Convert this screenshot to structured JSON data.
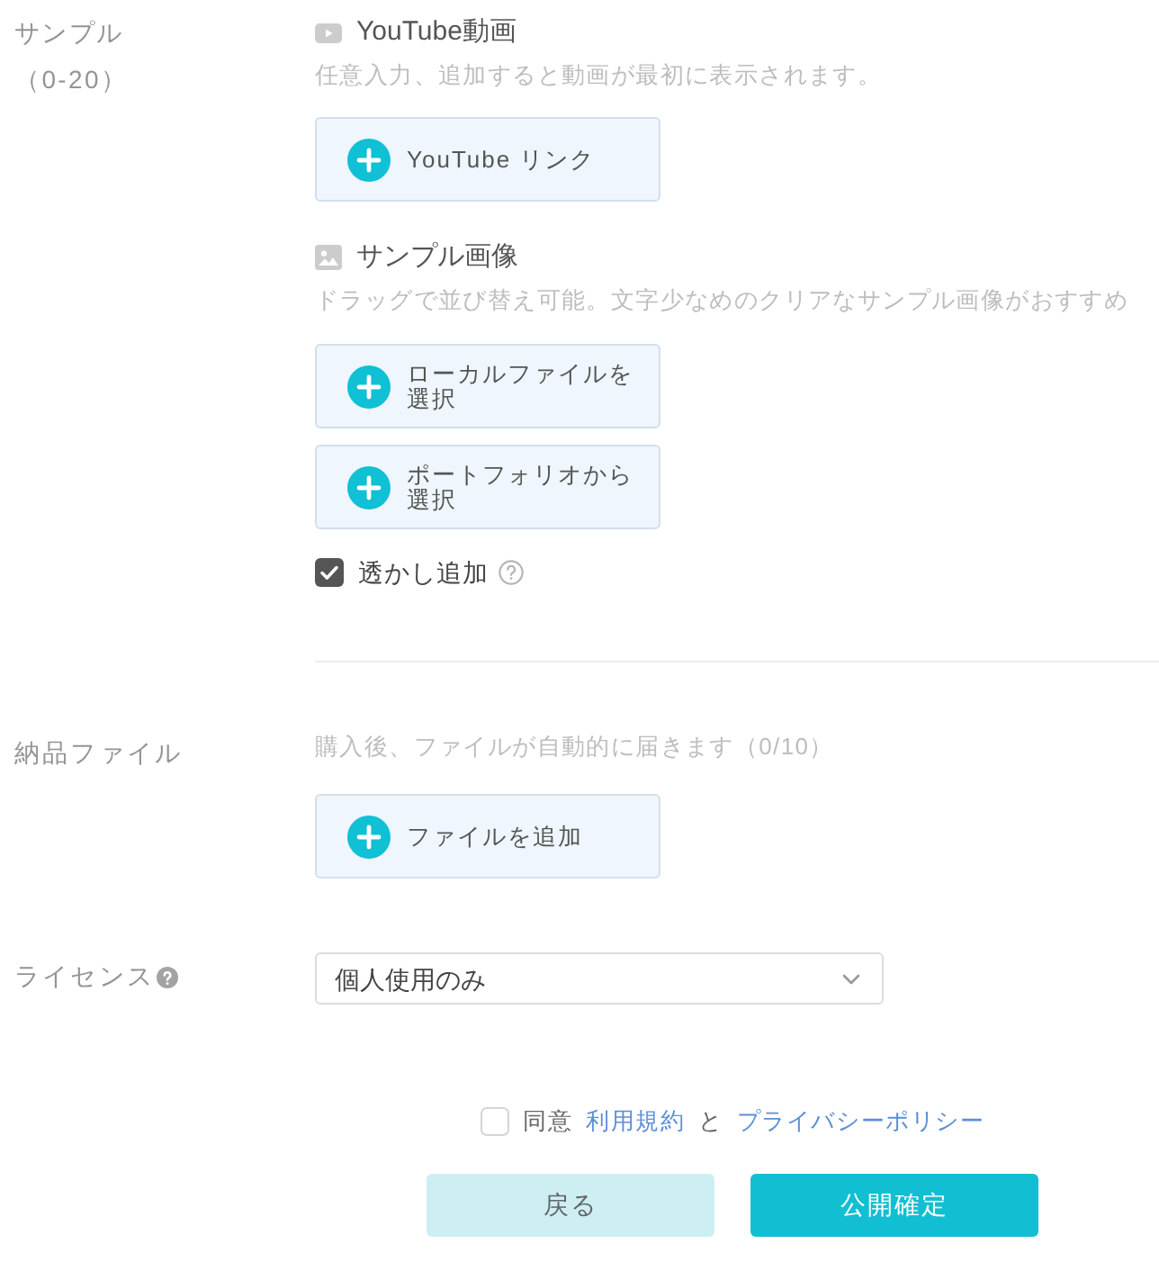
{
  "sample_section": {
    "label": "サンプル",
    "count": "（0-20）",
    "youtube": {
      "title": "YouTube動画",
      "hint": "任意入力、追加すると動画が最初に表示されます。",
      "buttons": [
        {
          "label": "YouTube リンク"
        }
      ]
    },
    "images": {
      "title": "サンプル画像",
      "hint": "ドラッグで並び替え可能。文字少なめのクリアなサンプル画像がおすすめ",
      "buttons": [
        {
          "label": "ローカルファイルを選択"
        },
        {
          "label": "ポートフォリオから選択"
        }
      ],
      "watermark": {
        "label": "透かし追加",
        "checked": true
      }
    }
  },
  "delivery_section": {
    "label": "納品ファイル",
    "hint": "購入後、ファイルが自動的に届きます（0/10）",
    "buttons": [
      {
        "label": "ファイルを追加"
      }
    ]
  },
  "license_section": {
    "label": "ライセンス",
    "select": {
      "value": "個人使用のみ"
    }
  },
  "agreement": {
    "checked": false,
    "parts": [
      {
        "kind": "text",
        "text": "同意"
      },
      {
        "kind": "link",
        "text": "利用規約"
      },
      {
        "kind": "text",
        "text": "と"
      },
      {
        "kind": "link",
        "text": "プライバシーポリシー"
      }
    ]
  },
  "buttons": [
    {
      "label": "戻る",
      "kind": "secondary"
    },
    {
      "label": "公開確定",
      "kind": "primary"
    }
  ]
}
